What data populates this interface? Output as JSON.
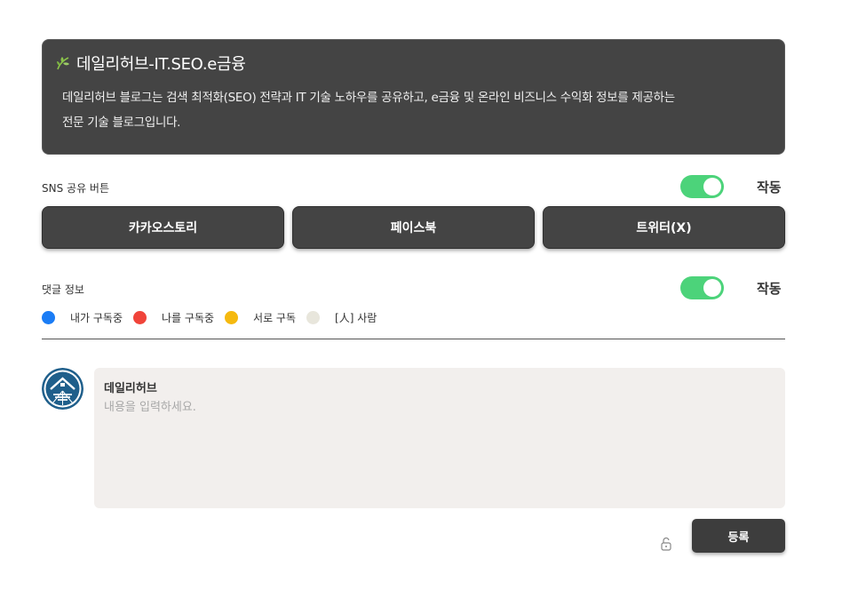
{
  "blog": {
    "title": "데일리허브-IT.SEO.e금융",
    "description_line1": "데일리허브 블로그는 검색 최적화(SEO) 전략과 IT 기술 노하우를 공유하고, e금융 및 온라인 비즈니스 수익화 정보를 제공하는",
    "description_line2": "전문 기술 블로그입니다.",
    "icon": "leaf-icon"
  },
  "sns": {
    "label": "SNS 공유 버튼",
    "status": "작동",
    "buttons": [
      {
        "label": "카카오스토리"
      },
      {
        "label": "페이스북"
      },
      {
        "label": "트위터(X)"
      }
    ]
  },
  "comments": {
    "label": "댓글 정보",
    "status": "작동",
    "legend": [
      {
        "label": "내가 구독중",
        "color": "#1a7cf5"
      },
      {
        "label": "나를 구독중",
        "color": "#f0443a"
      },
      {
        "label": "서로 구독",
        "color": "#f5b90f"
      },
      {
        "label": "[人] 사람",
        "color": "#e8e6dc"
      }
    ]
  },
  "comment_form": {
    "author": "데일리허브",
    "placeholder": "내용을 입력하세요.",
    "value": "",
    "submit_label": "등록",
    "lock_icon": "unlock-icon"
  },
  "colors": {
    "card_bg": "#444444",
    "toggle_on": "#4cd37a",
    "comment_bg": "#f2efed"
  }
}
